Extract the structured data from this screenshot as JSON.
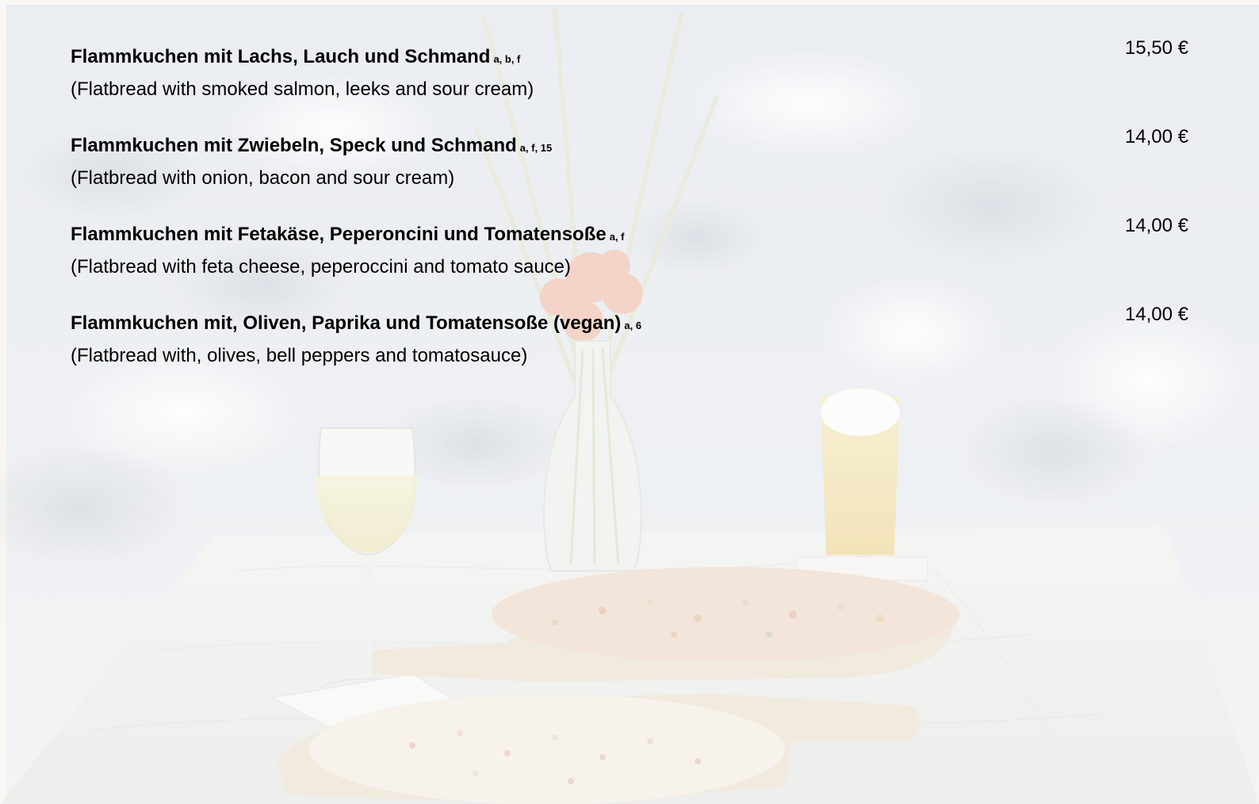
{
  "menu": {
    "items": [
      {
        "name": "Flammkuchen mit Lachs, Lauch und Schmand",
        "allergens": "a, b, f",
        "description": "(Flatbread with smoked salmon, leeks and sour cream)",
        "price": "15,50 €"
      },
      {
        "name": "Flammkuchen mit Zwiebeln, Speck und Schmand",
        "allergens": "a, f, 15",
        "description": "(Flatbread with onion, bacon and sour cream)",
        "price": "14,00 €"
      },
      {
        "name": "Flammkuchen mit Fetakäse, Peperoncini und Tomatensoße",
        "allergens": "a, f",
        "description": "(Flatbread with feta cheese, peperoccini and tomato sauce)",
        "price": "14,00 €"
      },
      {
        "name": "Flammkuchen mit, Oliven, Paprika und Tomatensoße (vegan)",
        "allergens": "a, 6",
        "description": "(Flatbread with, olives, bell peppers and tomatosauce)",
        "price": "14,00 €"
      }
    ]
  },
  "colors": {
    "background_wash": "#eef1f4",
    "text": "#000000"
  }
}
